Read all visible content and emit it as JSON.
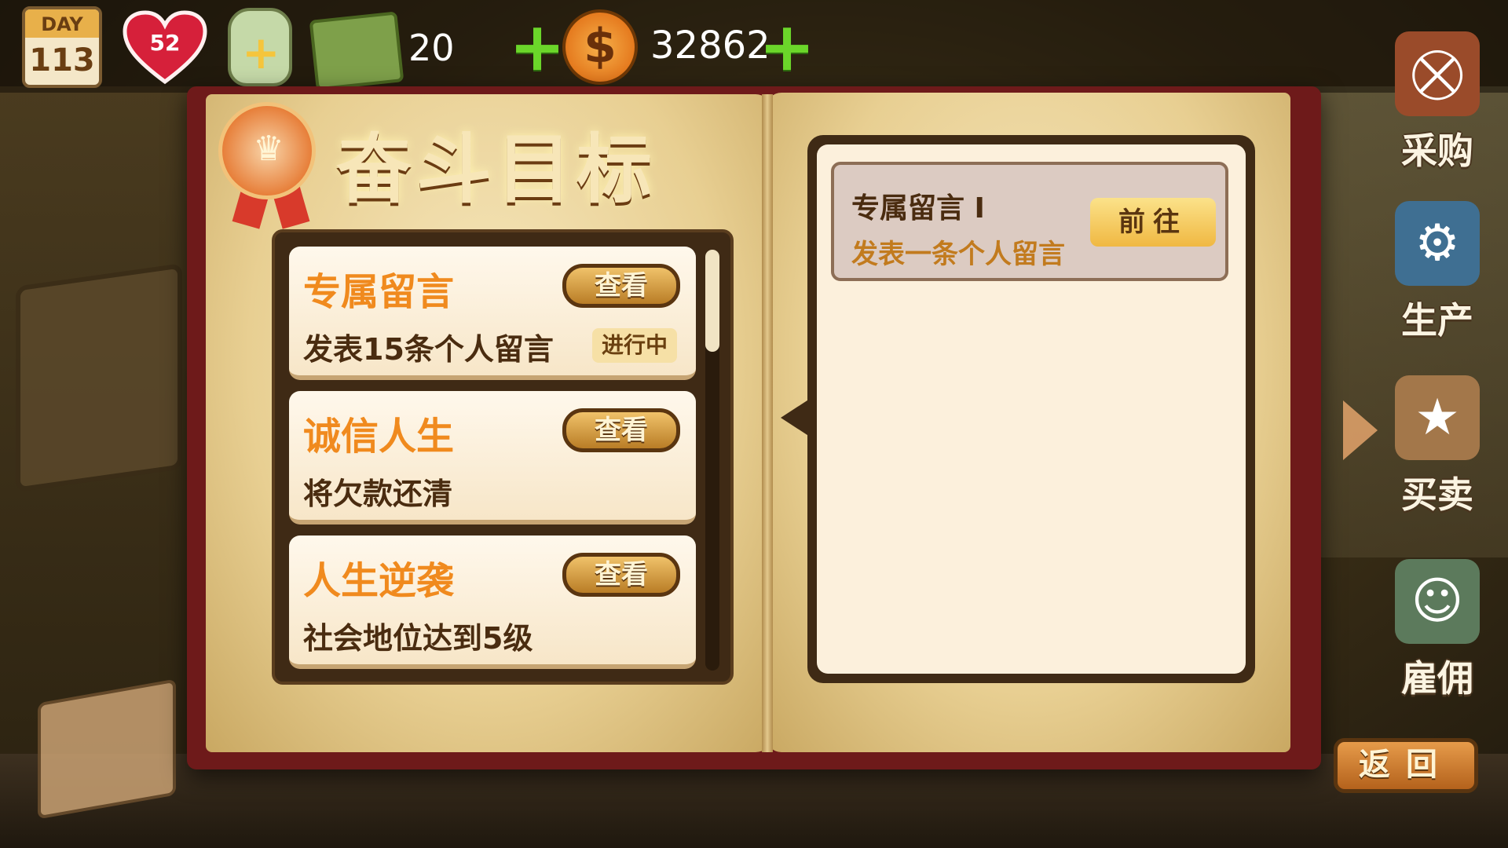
{
  "hud": {
    "day_label": "DAY",
    "day_value": "113",
    "health": "52",
    "cash": "20",
    "coins": "32862"
  },
  "book": {
    "title": "奋斗目标",
    "tasks": [
      {
        "title": "专属留言",
        "desc": "发表15条个人留言",
        "button": "查看",
        "status": "进行中"
      },
      {
        "title": "诚信人生",
        "desc": "将欠款还清",
        "button": "查看",
        "status": ""
      },
      {
        "title": "人生逆袭",
        "desc": "社会地位达到5级",
        "button": "查看",
        "status": ""
      }
    ],
    "detail": {
      "title": "专属留言 I",
      "desc": "发表一条个人留言",
      "button": "前往"
    }
  },
  "sidebar": {
    "items": [
      {
        "label": "采购",
        "icon": "basket-icon"
      },
      {
        "label": "生产",
        "icon": "machine-icon"
      },
      {
        "label": "买卖",
        "icon": "backpack-icon"
      },
      {
        "label": "雇佣",
        "icon": "worker-icon"
      }
    ]
  },
  "footer": {
    "back_label": "返回"
  },
  "colors": {
    "accent": "#f08a1e",
    "book_cover": "#6e1a1a",
    "page": "#f7e8bf"
  }
}
